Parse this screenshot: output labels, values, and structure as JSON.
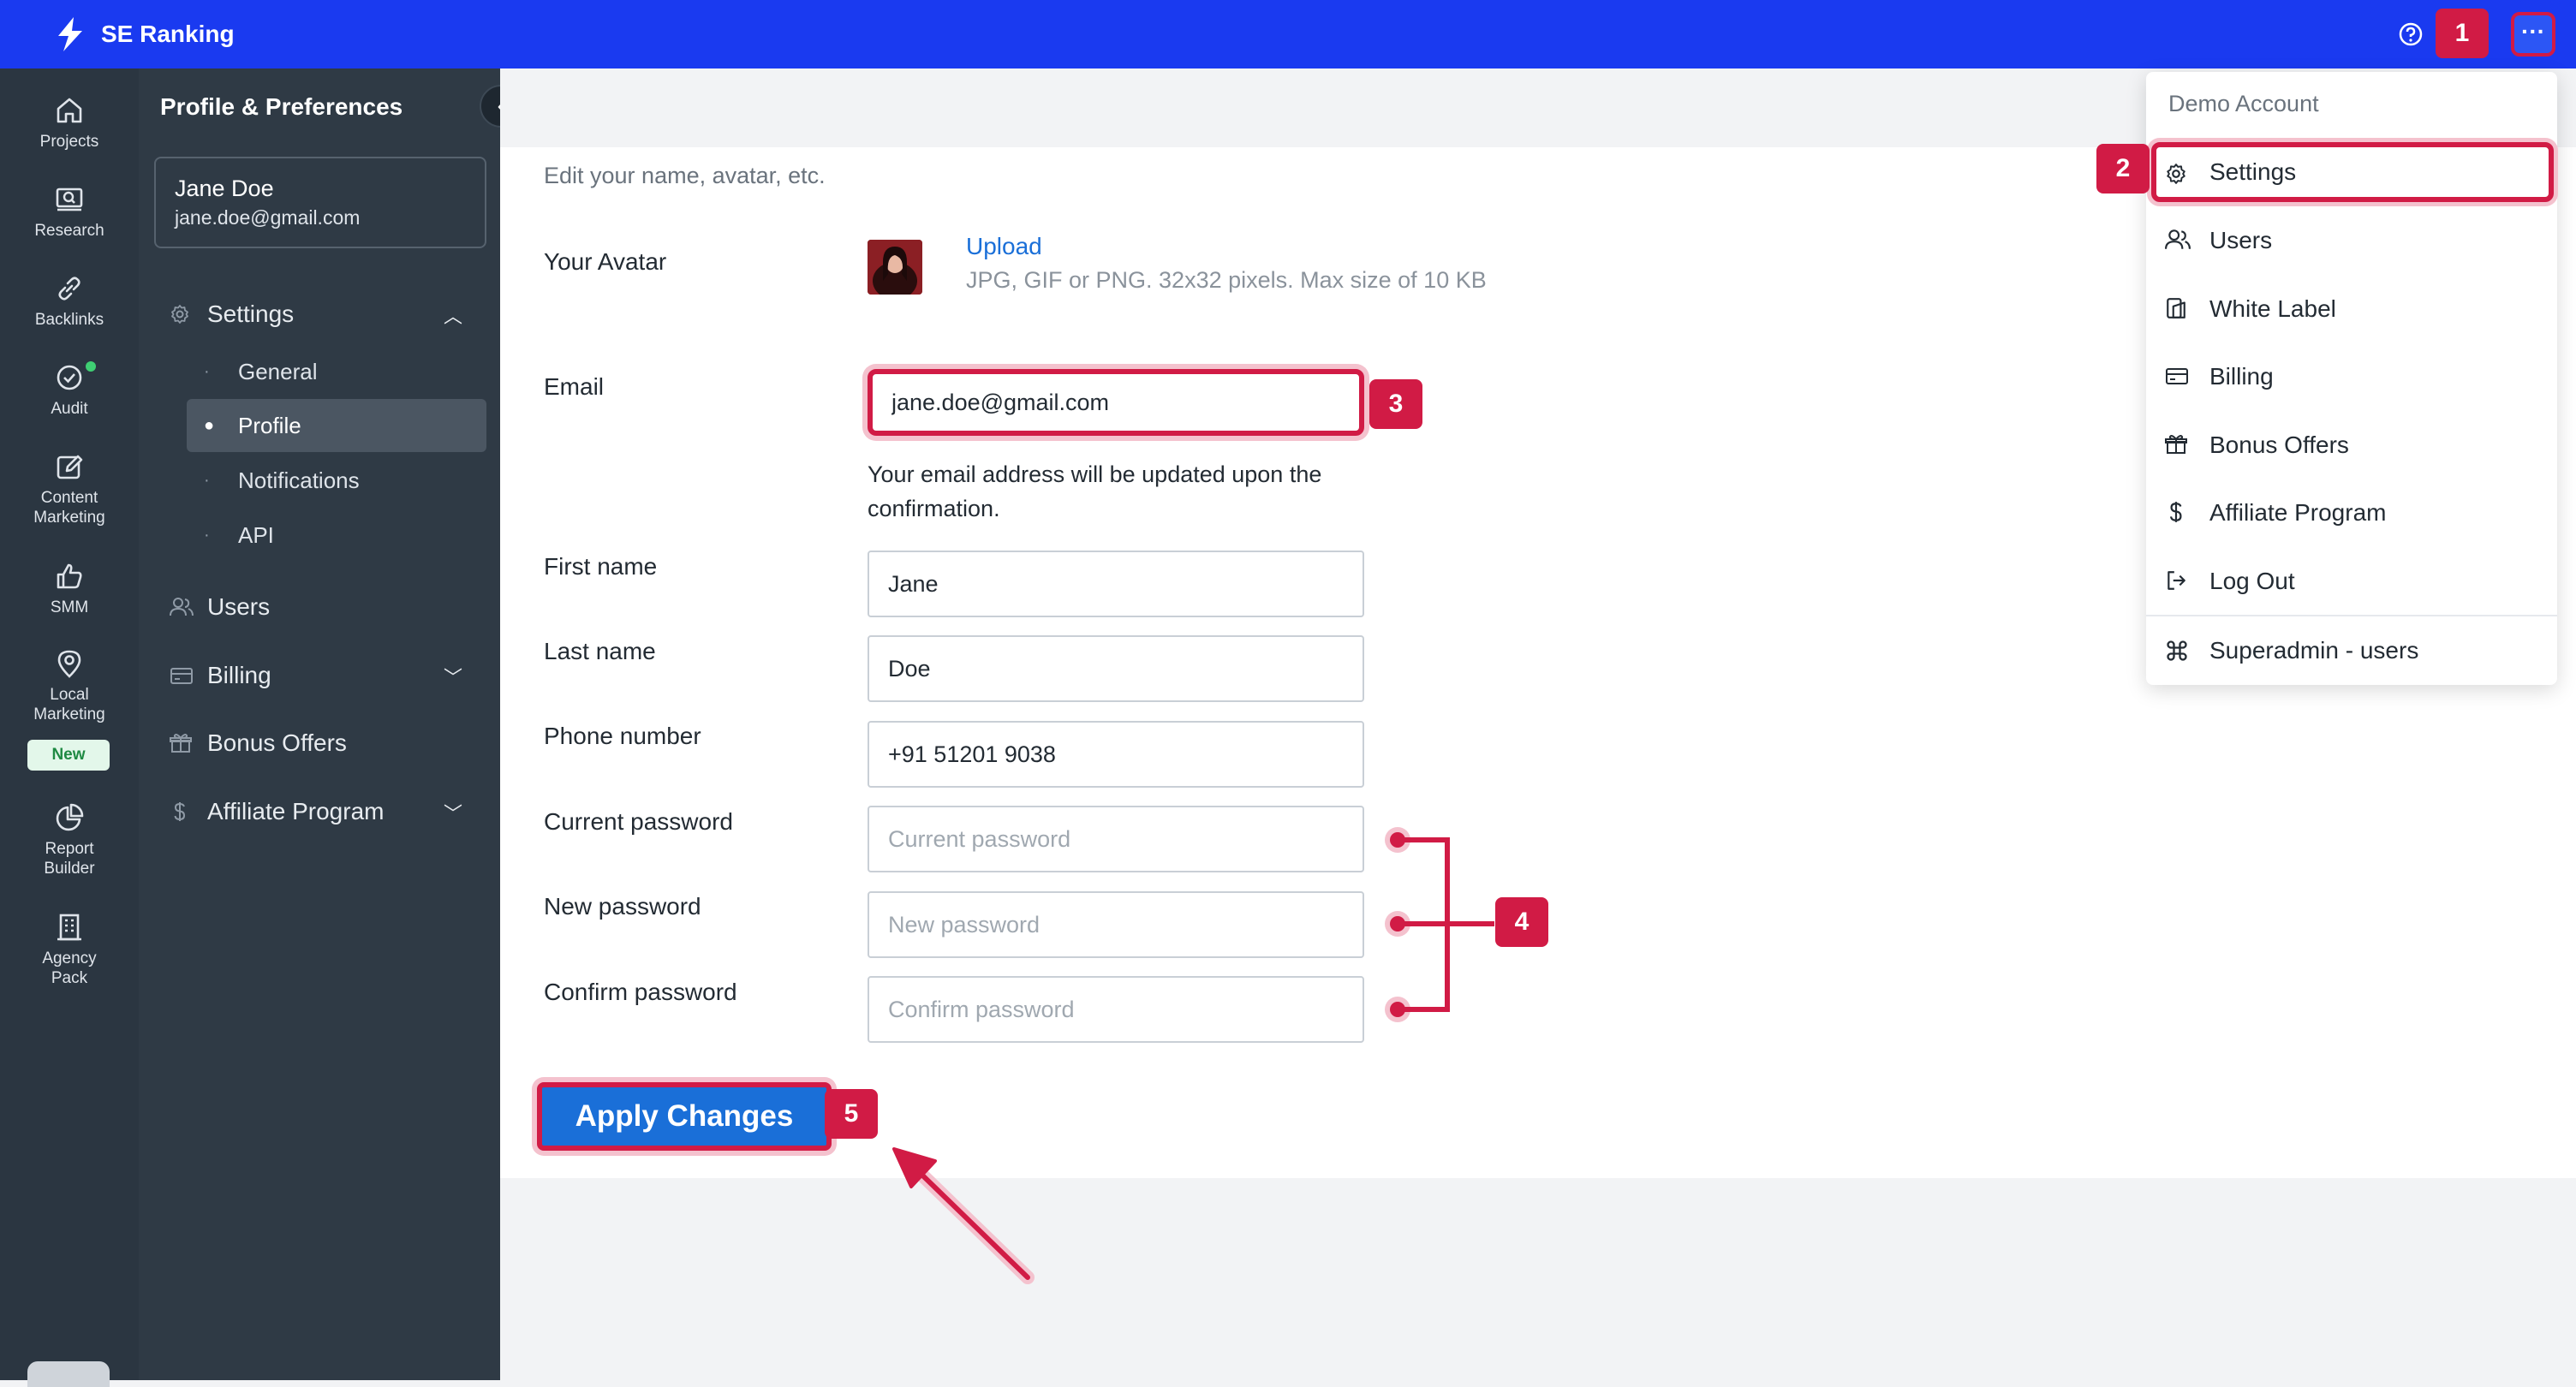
{
  "topbar": {
    "brand": "SE Ranking",
    "more_label": "···"
  },
  "rail": [
    {
      "label": "Projects",
      "icon": "home-icon"
    },
    {
      "label": "Research",
      "icon": "research-icon"
    },
    {
      "label": "Backlinks",
      "icon": "link-icon"
    },
    {
      "label": "Audit",
      "icon": "audit-check-icon"
    },
    {
      "label": "Content\nMarketing",
      "icon": "edit-icon"
    },
    {
      "label": "SMM",
      "icon": "thumbs-up-icon"
    },
    {
      "label": "Local\nMarketing",
      "icon": "map-pin-icon"
    },
    {
      "label": "Report\nBuilder",
      "icon": "pie-chart-icon"
    },
    {
      "label": "Agency\nPack",
      "icon": "building-icon"
    }
  ],
  "rail_new_badge": "New",
  "sidebar": {
    "title": "Profile & Preferences",
    "user": {
      "name": "Jane Doe",
      "email": "jane.doe@gmail.com"
    },
    "settings_label": "Settings",
    "sub_items": [
      "General",
      "Profile",
      "Notifications",
      "API"
    ],
    "users_label": "Users",
    "billing_label": "Billing",
    "bonus_label": "Bonus Offers",
    "affiliate_label": "Affiliate Program"
  },
  "main": {
    "subtitle": "Edit your name, avatar, etc.",
    "avatar_label": "Your Avatar",
    "upload_label": "Upload",
    "upload_hint": "JPG, GIF or PNG. 32x32 pixels. Max size of 10 KB",
    "email_label": "Email",
    "email_value": "jane.doe@gmail.com",
    "email_note": "Your email address will be updated upon the confirmation.",
    "first_name_label": "First name",
    "first_name_value": "Jane",
    "last_name_label": "Last name",
    "last_name_value": "Doe",
    "phone_label": "Phone number",
    "phone_value": "+91 51201 9038",
    "current_password_label": "Current password",
    "current_password_placeholder": "Current password",
    "new_password_label": "New password",
    "new_password_placeholder": "New password",
    "confirm_password_label": "Confirm password",
    "confirm_password_placeholder": "Confirm password",
    "apply_label": "Apply Changes"
  },
  "dropdown": {
    "header": "Demo Account",
    "items": [
      "Settings",
      "Users",
      "White Label",
      "Billing",
      "Bonus Offers",
      "Affiliate Program",
      "Log Out",
      "Superadmin - users"
    ]
  },
  "annotations": {
    "b1": "1",
    "b2": "2",
    "b3": "3",
    "b4": "4",
    "b5": "5"
  },
  "colors": {
    "topbar": "#1a3af0",
    "accent": "#1a6fd8",
    "annotation": "#d11b45",
    "sidebar": "#2f3a45",
    "rail": "#2b3641"
  }
}
